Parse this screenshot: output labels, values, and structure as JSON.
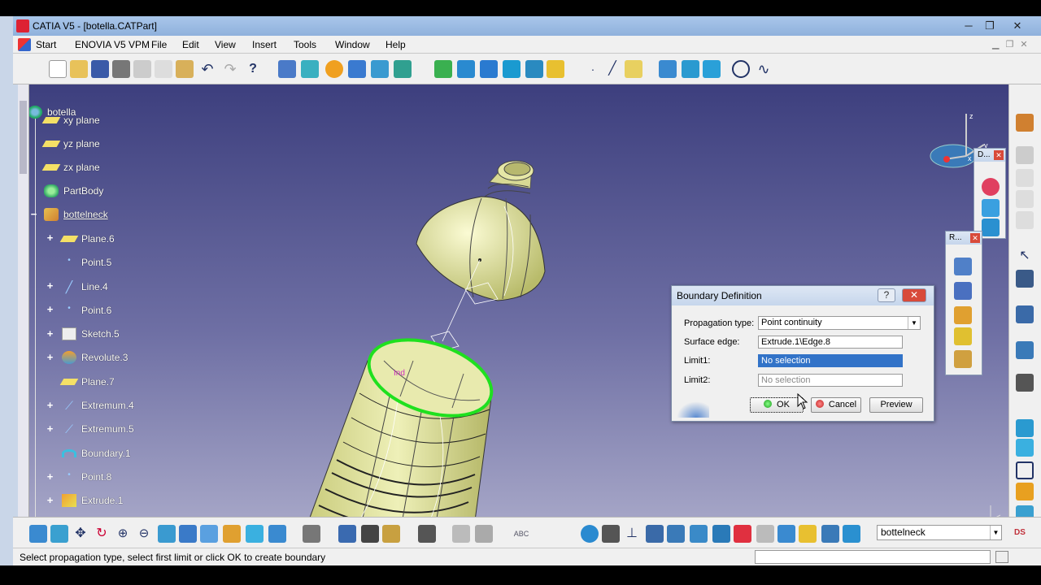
{
  "window": {
    "title": "CATIA V5 - [botella.CATPart]",
    "minimize": "─",
    "restore": "❐",
    "close": "✕"
  },
  "menu": {
    "items": [
      "Start",
      "ENOVIA V5 VPM",
      "File",
      "Edit",
      "View",
      "Insert",
      "Tools",
      "Window",
      "Help"
    ]
  },
  "tree": {
    "root": "botella",
    "items": [
      {
        "label": "xy plane",
        "icon": "plane-icon"
      },
      {
        "label": "yz plane",
        "icon": "plane-icon"
      },
      {
        "label": "zx plane",
        "icon": "plane-icon"
      },
      {
        "label": "PartBody",
        "icon": "partbody-icon"
      },
      {
        "label": "bottelneck",
        "icon": "geometrical-set-icon"
      },
      {
        "label": "Plane.6",
        "icon": "plane-icon"
      },
      {
        "label": "Point.5",
        "icon": "point-icon"
      },
      {
        "label": "Line.4",
        "icon": "line-icon"
      },
      {
        "label": "Point.6",
        "icon": "point-icon"
      },
      {
        "label": "Sketch.5",
        "icon": "sketch-icon"
      },
      {
        "label": "Revolute.3",
        "icon": "revolute-icon"
      },
      {
        "label": "Plane.7",
        "icon": "plane-icon"
      },
      {
        "label": "Extremum.4",
        "icon": "extremum-icon"
      },
      {
        "label": "Extremum.5",
        "icon": "extremum-icon"
      },
      {
        "label": "Boundary.1",
        "icon": "boundary-icon"
      },
      {
        "label": "Point.8",
        "icon": "point-icon"
      },
      {
        "label": "Extrude.1",
        "icon": "extrude-icon"
      }
    ]
  },
  "dialog": {
    "title": "Boundary Definition",
    "help": "?",
    "close": "✕",
    "propagation_label": "Propagation type:",
    "propagation_value": "Point continuity",
    "surface_edge_label": "Surface edge:",
    "surface_edge_value": "Extrude.1\\Edge.8",
    "limit1_label": "Limit1:",
    "limit1_value": "No selection",
    "limit2_label": "Limit2:",
    "limit2_value": "No selection",
    "ok": "OK",
    "cancel": "Cancel",
    "preview": "Preview"
  },
  "panels": {
    "panel_d_title": "D...",
    "panel_r_title": "R..."
  },
  "viewport": {
    "annotation": "Ind"
  },
  "bottom": {
    "current_body": "bottelneck"
  },
  "status": {
    "message": "Select propagation type, select first limit or click OK to create boundary"
  },
  "colors": {
    "viewport_top": "#3d3f7e",
    "viewport_bottom": "#a9a9c9",
    "part_surface": "#e4e6a6",
    "highlight_edge": "#1fe01f",
    "selection_blue": "#3273c8"
  }
}
